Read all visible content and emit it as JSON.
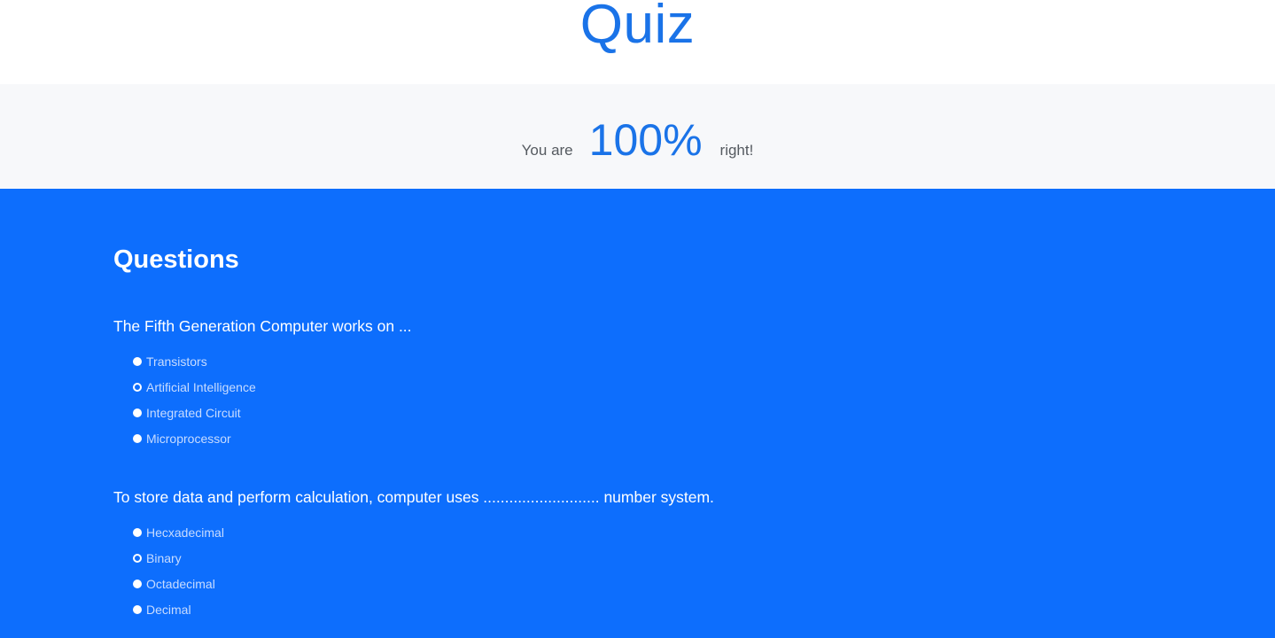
{
  "header": {
    "title": "Quiz"
  },
  "score": {
    "prefix": "You are",
    "value": "100%",
    "suffix": "right!"
  },
  "questions_section": {
    "heading": "Questions",
    "questions": [
      {
        "text": "The Fifth Generation Computer works on ...",
        "options": [
          {
            "label": "Transistors",
            "selected": false
          },
          {
            "label": "Artificial Intelligence",
            "selected": true
          },
          {
            "label": "Integrated Circuit",
            "selected": false
          },
          {
            "label": "Microprocessor",
            "selected": false
          }
        ]
      },
      {
        "text": "To store data and perform calculation, computer uses ........................... number system.",
        "options": [
          {
            "label": "Hecxadecimal",
            "selected": false
          },
          {
            "label": "Binary",
            "selected": true
          },
          {
            "label": "Octadecimal",
            "selected": false
          },
          {
            "label": "Decimal",
            "selected": false
          }
        ]
      }
    ]
  },
  "colors": {
    "accent": "#1a73e8",
    "section_background": "#0d6efd",
    "score_band_background": "#f7f8fa"
  }
}
